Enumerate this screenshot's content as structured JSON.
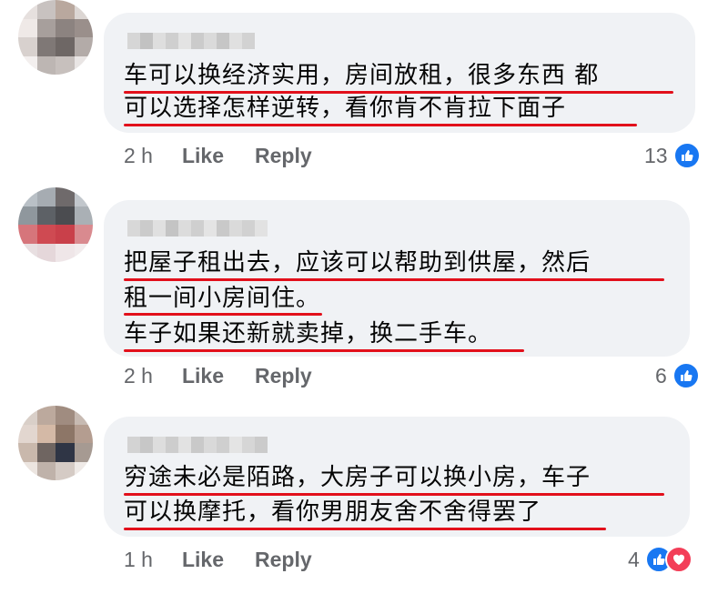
{
  "comments": [
    {
      "lines": [
        "车可以换经济实用，房间放租，很多东西 都",
        "可以选择怎样逆转，看你肯不肯拉下面子"
      ],
      "time": "2 h",
      "like": "Like",
      "reply": "Reply",
      "reaction_count": "13",
      "reactions": [
        "like-icon"
      ]
    },
    {
      "lines": [
        "把屋子租出去，应该可以帮助到供屋，然后",
        "租一间小房间住。",
        "车子如果还新就卖掉，换二手车。"
      ],
      "time": "2 h",
      "like": "Like",
      "reply": "Reply",
      "reaction_count": "6",
      "reactions": [
        "like-icon"
      ]
    },
    {
      "lines": [
        "穷途未必是陌路，大房子可以换小房，车子",
        "可以换摩托，看你男朋友舍不舍得罢了"
      ],
      "time": "1 h",
      "like": "Like",
      "reply": "Reply",
      "reaction_count": "4",
      "reactions": [
        "like-icon",
        "love-icon"
      ]
    }
  ],
  "colors": {
    "bubble": "#f0f2f5",
    "underline": "#e2101b",
    "like": "#1877f2",
    "love": "#f33e58",
    "meta": "#65676b"
  }
}
